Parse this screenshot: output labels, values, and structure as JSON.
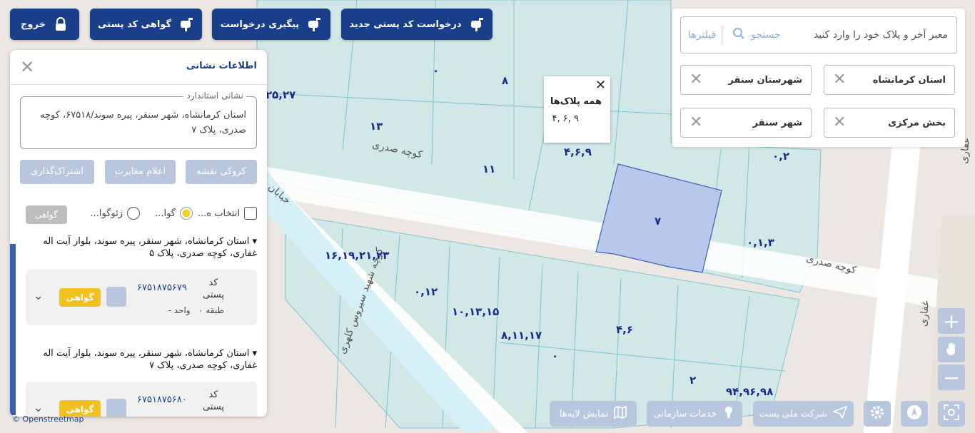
{
  "toolbar": {
    "logout": "خروج",
    "postal_certificate": "گواهی کد پستی",
    "track_request": "پیگیری درخواست",
    "new_postal_request": "درخواست کد پستی جدید"
  },
  "filters": {
    "search_placeholder": "معبر آخر و پلاک خود را وارد کنید",
    "search_label": "جستجو",
    "filters_label": "فیلترها",
    "chips": [
      "استان کرمانشاه",
      "شهرستان سنقر",
      "بخش مرکزی",
      "شهر سنقر"
    ]
  },
  "info_panel": {
    "title": "اطلاعات نشانی",
    "standard_address_legend": "نشانی استاندارد",
    "standard_address": "استان کرمانشاه، شهر سنقر، پیره سوند/۶۷۵۱۸، کوچه صدری، پلاک ۷",
    "buttons": {
      "map_sketch": "کروکی نقشه",
      "report_mismatch": "اعلام مغایرت",
      "share": "اشتراک‌گذاری"
    },
    "radios": {
      "select_all": "انتخاب ه...",
      "gava": "گوا...",
      "geo": "ژئوگوا..."
    },
    "gavahi_button": "گواهی",
    "records": [
      {
        "address": "▾ استان کرمانشاه، شهر سنقر، پیره سوند، بلوار آیت اله غفاری، کوچه صدری، پلاک ۵",
        "code_label": "کد پستی",
        "code": "۶۷۵۱۸۷۵۶۷۹",
        "floor": "طبقه ۰",
        "unit": "واحد -",
        "cert": "گواهی"
      },
      {
        "address": "▾ استان کرمانشاه، شهر سنقر، پیره سوند، بلوار آیت اله غفاری، کوچه صدری، پلاک ۷",
        "code_label": "کد پستی",
        "code": "۶۷۵۱۸۷۵۶۸۰",
        "floor": "",
        "unit": "",
        "cert": "گواهی"
      }
    ]
  },
  "popup": {
    "title": "همه پلاک‌ها",
    "value": "۴, ۶, ۹"
  },
  "map": {
    "street_labels": [
      "کوچه صدری",
      "کوچه صدری",
      "کوچه شهید سیروس کلهری",
      "خیابان",
      "غفاری",
      "غفاری"
    ],
    "plates": [
      "۰",
      "۸",
      "۲۵,۲۷",
      "۱۳",
      "۴,۶,۹",
      "۱۱",
      "۰,۲",
      "۷",
      "۰,۱,۳",
      "۱۶,۱۹,۲۱,۲۳",
      "۰,۱۲",
      "۱۰,۱۳,۱۵",
      "۸,۱۱,۱۷",
      "۴,۶",
      "۰",
      "۲",
      "۹۴,۹۶,۹۸"
    ],
    "attribution": "© Openstreetmap"
  },
  "bottom_bar": {
    "layers": "نمایش لایه‌ها",
    "org_services": "خدمات سازمانی",
    "national_post": "شرکت ملی پست"
  }
}
